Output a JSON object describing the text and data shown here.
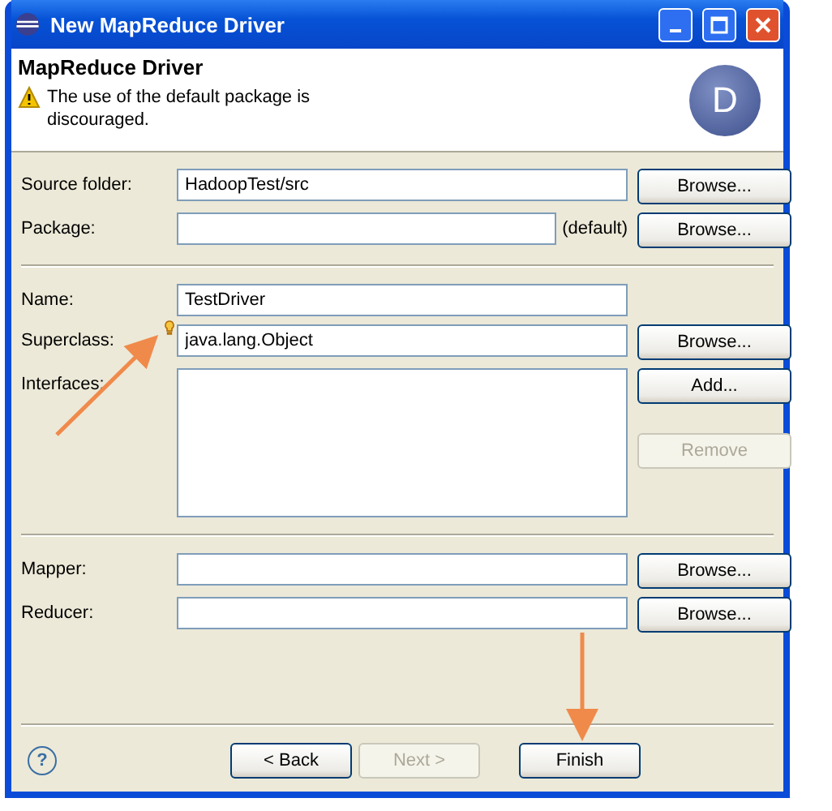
{
  "window": {
    "title": "New MapReduce Driver"
  },
  "header": {
    "title": "MapReduce Driver",
    "message": "The use of the default package is discouraged.",
    "warning": true,
    "badge": "D"
  },
  "sections": [
    [
      {
        "kind": "field",
        "label": "Source folder:",
        "value": "HadoopTest/src",
        "buttons": [
          {
            "label": "Browse...",
            "disabled": false
          }
        ]
      },
      {
        "kind": "field",
        "label": "Package:",
        "note": "(default)",
        "buttons": [
          {
            "label": "Browse...",
            "disabled": false
          }
        ]
      }
    ],
    [
      {
        "kind": "field",
        "label": "Name:",
        "value": "TestDriver"
      },
      {
        "kind": "field",
        "label": "Superclass:",
        "value": "java.lang.Object",
        "content_assist": true,
        "buttons": [
          {
            "label": "Browse...",
            "disabled": false
          }
        ]
      },
      {
        "kind": "list",
        "label": "Interfaces:",
        "buttons": [
          {
            "label": "Add...",
            "disabled": false
          },
          {
            "label": "Remove",
            "disabled": true
          }
        ]
      }
    ],
    [
      {
        "kind": "field",
        "label": "Mapper:",
        "buttons": [
          {
            "label": "Browse...",
            "disabled": false
          }
        ]
      },
      {
        "kind": "field",
        "label": "Reducer:",
        "buttons": [
          {
            "label": "Browse...",
            "disabled": false
          }
        ]
      }
    ]
  ],
  "footer": {
    "help_icon": "?",
    "buttons": [
      {
        "label": "< Back",
        "disabled": false
      },
      {
        "label": "Next >",
        "disabled": true
      },
      {
        "label": "Finish",
        "disabled": false
      }
    ]
  }
}
